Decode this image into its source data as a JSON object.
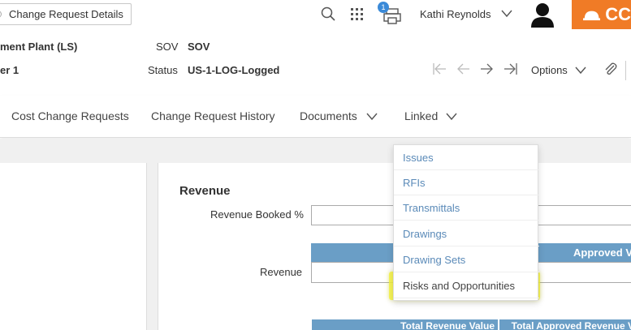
{
  "header": {
    "crumb": "Change Request Details",
    "notification_count": "1",
    "user_name": "Kathi Reynolds",
    "brand_text": "CC"
  },
  "info": {
    "plant": "ment Plant (LS)",
    "version": "er 1",
    "sov_label": "SOV",
    "sov_value": "SOV",
    "status_label": "Status",
    "status_value": "US-1-LOG-Logged",
    "options_label": "Options"
  },
  "tabs": {
    "cost": "Cost Change Requests",
    "history": "Change Request History",
    "documents": "Documents",
    "linked": "Linked"
  },
  "revenue": {
    "title": "Revenue",
    "booked_label": "Revenue Booked %",
    "revenue_label": "Revenue",
    "approved_header": "Approved V",
    "total_revenue_header": "Total Revenue Value",
    "total_approved_header": "Total Approved Revenue V"
  },
  "linked_menu": {
    "items": [
      "Issues",
      "RFIs",
      "Transmittals",
      "Drawings",
      "Drawing Sets",
      "Risks and Opportunities"
    ]
  },
  "colors": {
    "brand": "#f07b26",
    "link": "#5a8ab8",
    "table_header": "#6a9ec6",
    "highlight": "#f5f33a"
  }
}
